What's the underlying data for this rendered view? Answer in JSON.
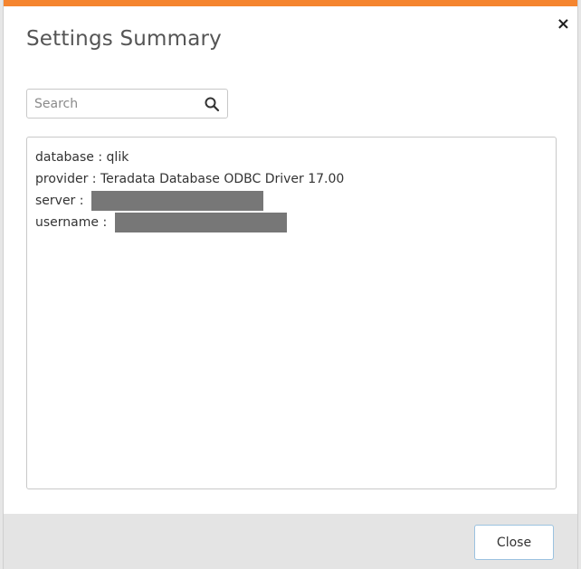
{
  "dialog": {
    "title": "Settings Summary",
    "close_glyph": "×"
  },
  "search": {
    "placeholder": "Search",
    "value": ""
  },
  "summary": {
    "rows": [
      {
        "key": "database",
        "separator": " : ",
        "value": "qlik"
      },
      {
        "key": "provider",
        "separator": " : ",
        "value": "Teradata Database ODBC Driver 17.00"
      },
      {
        "key": "server",
        "separator": " : ",
        "value": ""
      },
      {
        "key": "username",
        "separator": " : ",
        "value": ""
      }
    ]
  },
  "footer": {
    "close_label": "Close"
  },
  "colors": {
    "accent": "#f5852f",
    "redaction": "#777777"
  }
}
